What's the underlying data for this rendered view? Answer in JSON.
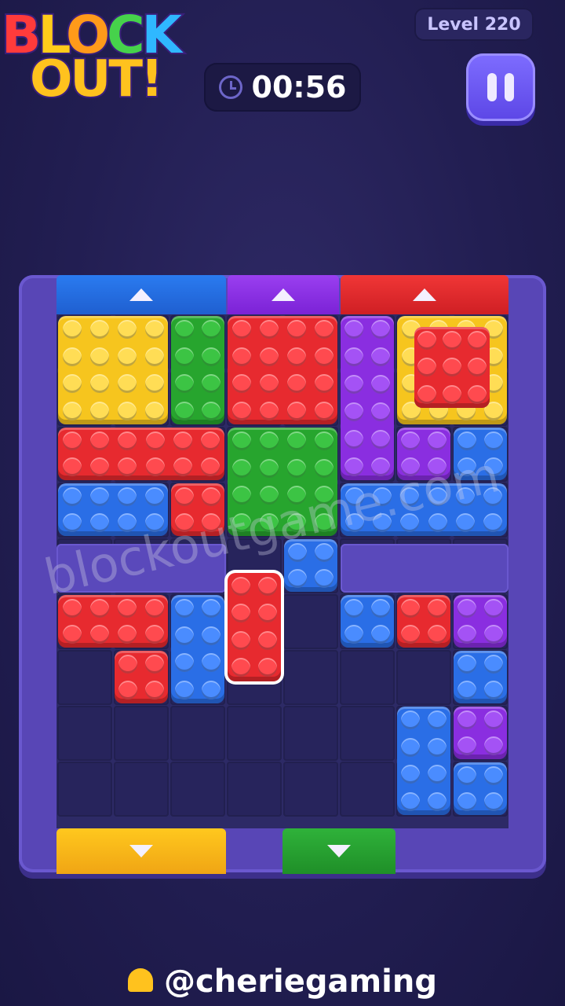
{
  "logo": {
    "line1": [
      "B",
      "L",
      "O",
      "C",
      "K"
    ],
    "line2": "OUT!"
  },
  "header": {
    "level": "Level 220",
    "timer": "00:56"
  },
  "watermark": "blockoutgame.com",
  "handle": "@cheriegaming",
  "colors": {
    "red": "#e72a2f",
    "yellow": "#f6c51e",
    "green": "#27a52e",
    "blue": "#2a6ee6",
    "purple": "#8a2ee0"
  },
  "gates": [
    {
      "side": "top",
      "color": "blue",
      "direction": "up"
    },
    {
      "side": "top",
      "color": "purple",
      "direction": "up"
    },
    {
      "side": "top",
      "color": "red",
      "direction": "up"
    },
    {
      "side": "bottom",
      "color": "yellow",
      "direction": "down"
    },
    {
      "side": "bottom",
      "color": "green",
      "direction": "down"
    }
  ],
  "grid": {
    "cols": 8,
    "rows": 9
  }
}
